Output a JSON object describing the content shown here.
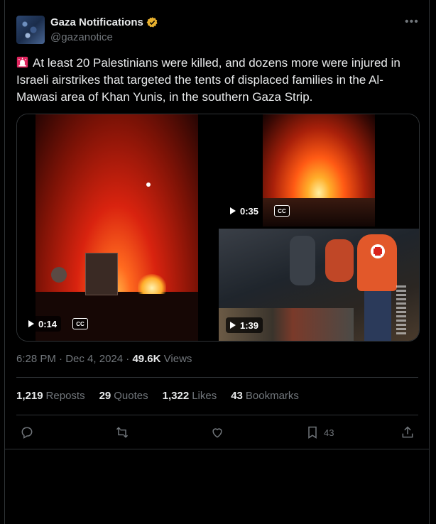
{
  "author": {
    "name": "Gaza Notifications",
    "handle": "@gazanotice",
    "verified_color": "#e8b02e"
  },
  "more_icon": "more-dots-icon",
  "tweet": {
    "emoji": "rotating-light",
    "text": "At least 20 Palestinians were killed, and dozens more were injured in Israeli airstrikes that targeted the tents of displaced families in the Al-Mawasi area of Khan Yunis, in the southern Gaza Strip."
  },
  "media": [
    {
      "duration": "0:14",
      "cc": "CC"
    },
    {
      "duration": "0:35",
      "cc": "CC"
    },
    {
      "duration": "1:39"
    }
  ],
  "meta": {
    "time": "6:28 PM",
    "date": "Dec 4, 2024",
    "views_count": "49.6K",
    "views_label": "Views"
  },
  "stats": {
    "reposts_count": "1,219",
    "reposts_label": "Reposts",
    "quotes_count": "29",
    "quotes_label": "Quotes",
    "likes_count": "1,322",
    "likes_label": "Likes",
    "bookmarks_count": "43",
    "bookmarks_label": "Bookmarks"
  },
  "actions": {
    "bookmark_count": "43"
  },
  "colors": {
    "background": "#000000",
    "text": "#e7e9ea",
    "muted": "#71767b",
    "border": "#2f3336"
  }
}
